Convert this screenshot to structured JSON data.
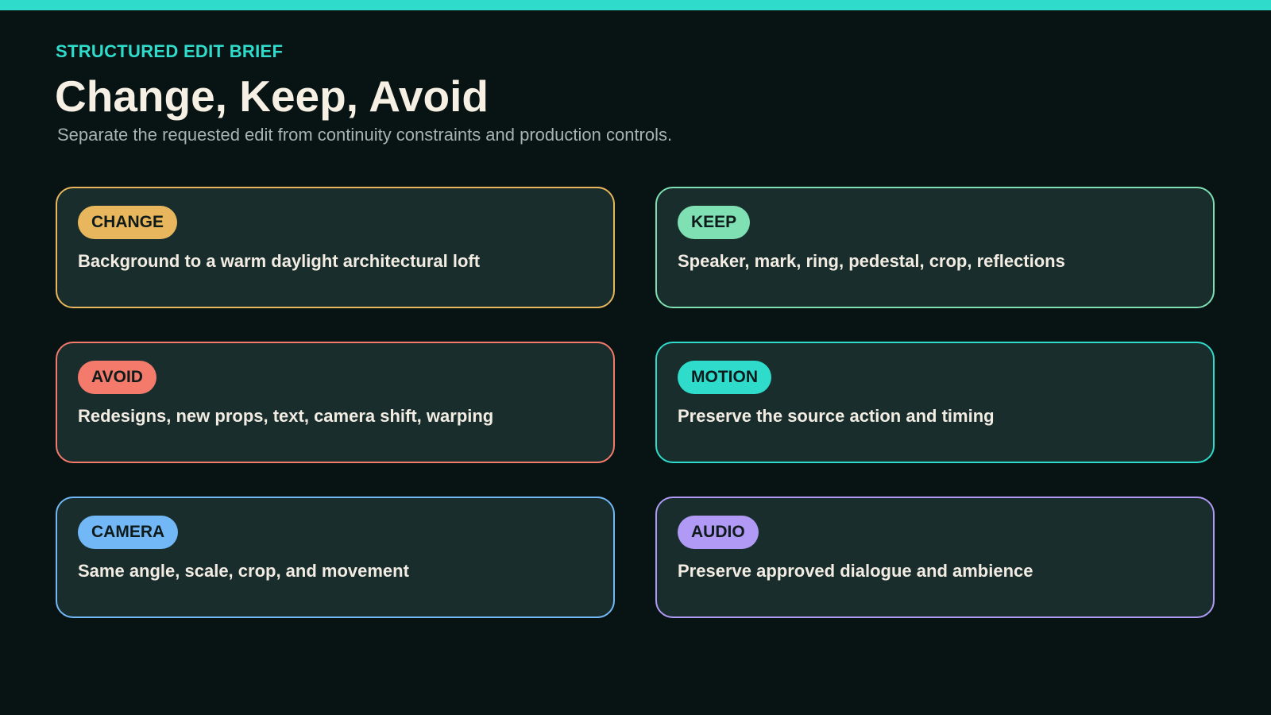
{
  "header": {
    "eyebrow": "STRUCTURED EDIT BRIEF",
    "title": "Change, Keep, Avoid",
    "subtitle": "Separate the requested edit from continuity constraints and production controls."
  },
  "colors": {
    "background": "#081313",
    "accent_bar": "#2fdccc",
    "card_fill": "#182d2c"
  },
  "cards": [
    {
      "label": "CHANGE",
      "text": "Background to a warm daylight architectural loft",
      "color": "#e8b65c"
    },
    {
      "label": "KEEP",
      "text": "Speaker, mark, ring, pedestal, crop, reflections",
      "color": "#7fe0b3"
    },
    {
      "label": "AVOID",
      "text": "Redesigns, new props, text, camera shift, warping",
      "color": "#f47a6c"
    },
    {
      "label": "MOTION",
      "text": "Preserve the source action and timing",
      "color": "#2fdccc"
    },
    {
      "label": "CAMERA",
      "text": "Same angle, scale, crop, and movement",
      "color": "#72b8f6"
    },
    {
      "label": "AUDIO",
      "text": "Preserve approved dialogue and ambience",
      "color": "#b09af5"
    }
  ]
}
